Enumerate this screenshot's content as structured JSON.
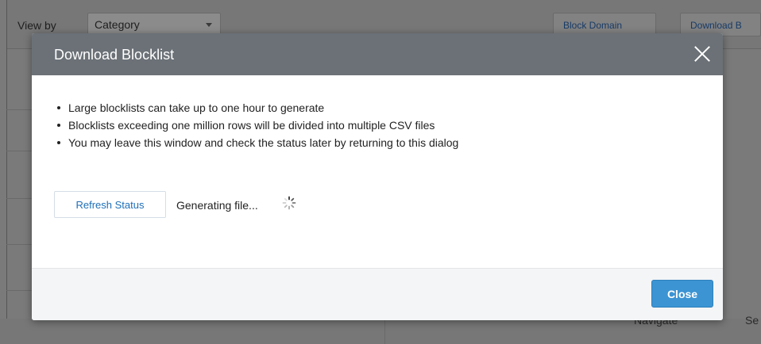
{
  "background": {
    "view_by_label": "View by",
    "view_by_value": "Category",
    "block_domain_label": "Block Domain",
    "download_label": "Download B",
    "navigate_label": "Navigate",
    "se_label": "Se"
  },
  "modal": {
    "title": "Download Blocklist",
    "bullets": [
      "Large blocklists can take up to one hour to generate",
      "Blocklists exceeding one million rows will be divided into multiple CSV files",
      "You may leave this window and check the status later by returning to this dialog"
    ],
    "refresh_label": "Refresh Status",
    "status_text": "Generating file...",
    "close_label": "Close"
  },
  "colors": {
    "header_bg": "#6b7177",
    "primary_button": "#3c94d3",
    "link_blue": "#1e6fb8"
  },
  "icons": {
    "close": "close-x-icon",
    "spinner": "loading-spinner-icon"
  }
}
